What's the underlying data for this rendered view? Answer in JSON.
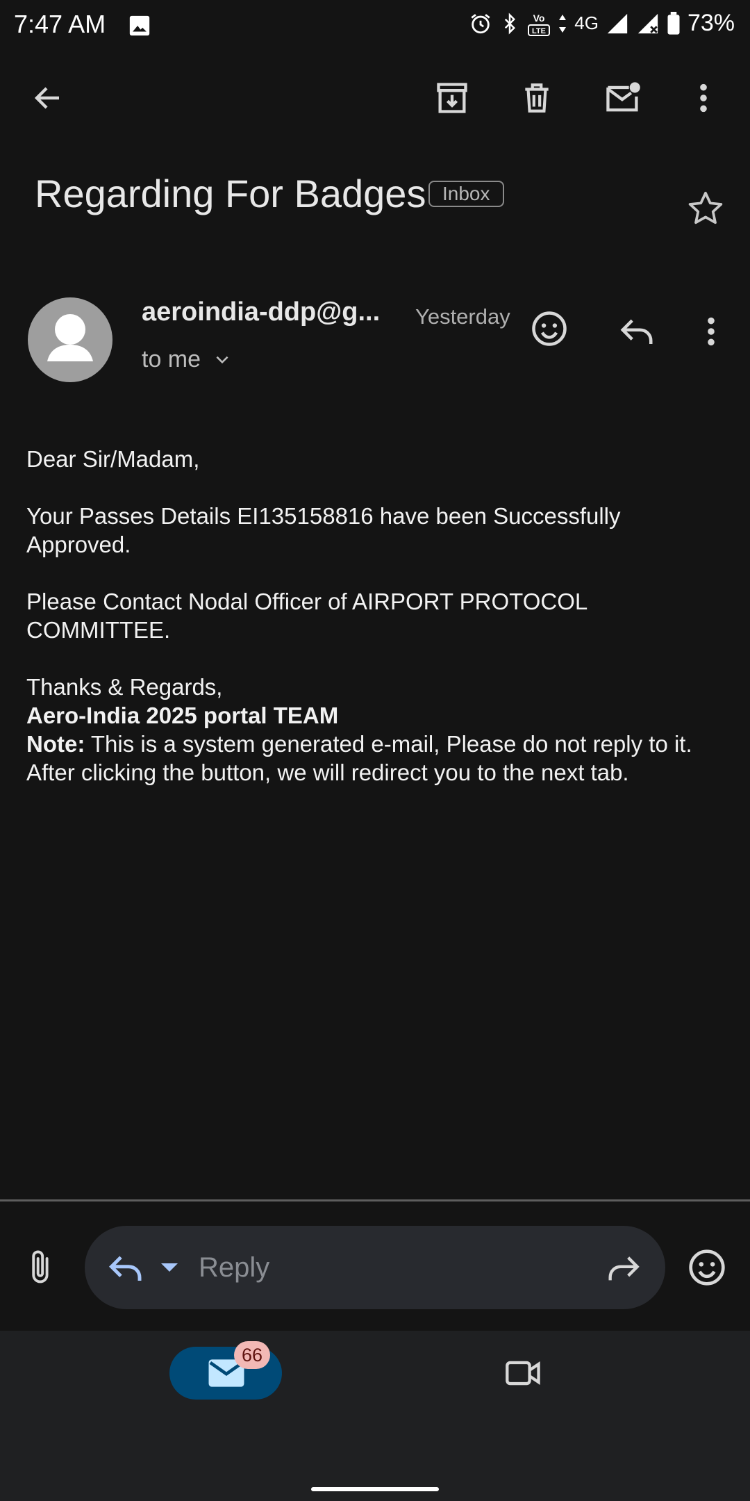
{
  "status_bar": {
    "time": "7:47 AM",
    "network": "4G",
    "volte": "VoLTE",
    "battery": "73%",
    "icons": [
      "gallery-icon",
      "alarm-icon",
      "bluetooth-icon",
      "volte-icon",
      "signal-icon",
      "battery-icon"
    ]
  },
  "toolbar": {
    "icons": [
      "back-arrow-icon",
      "archive-icon",
      "delete-icon",
      "mark-unread-icon",
      "more-vert-icon"
    ]
  },
  "email": {
    "subject": "Regarding For Badges",
    "label": "Inbox",
    "sender": "aeroindia-ddp@g...",
    "date": "Yesterday",
    "recipient": "to me",
    "body": {
      "greeting": "Dear Sir/Madam,",
      "line1": "Your Passes Details EI135158816 have been Successfully Approved.",
      "line2": "Please Contact Nodal Officer of AIRPORT PROTOCOL COMMITTEE.",
      "closing": "Thanks & Regards,",
      "team": "Aero-India 2025 portal TEAM",
      "note_label": "Note:",
      "note_text": " This is a system generated e-mail, Please do not reply to it.",
      "redirect": "After clicking the button, we will redirect you to the next tab."
    }
  },
  "reply_bar": {
    "placeholder": "Reply"
  },
  "bottom_nav": {
    "mail_badge": "66",
    "tabs": [
      "mail-icon",
      "meet-icon"
    ]
  },
  "colors": {
    "background": "#141414",
    "reply_pill": "#282a2f",
    "accent_blue": "#a8c7fa",
    "active_tab": "#004a77",
    "badge": "#f2b8b5",
    "nav_bg": "#1f2022"
  }
}
